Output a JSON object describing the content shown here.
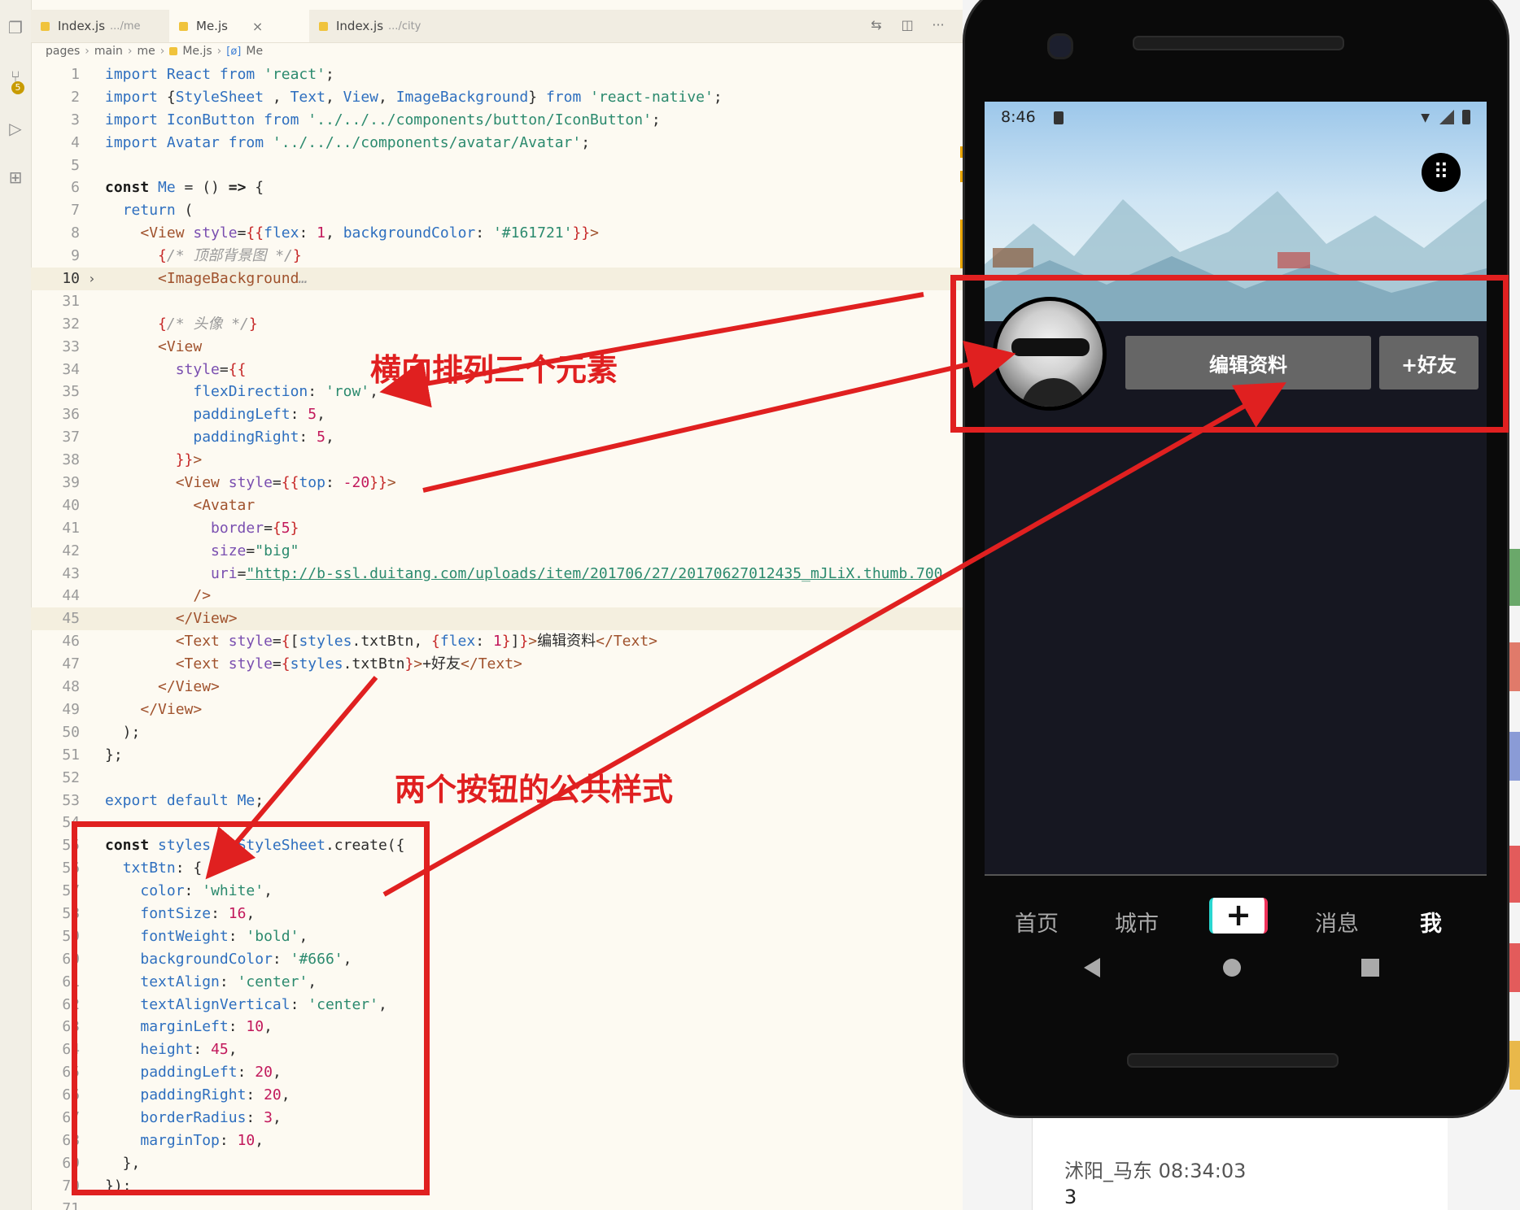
{
  "editor": {
    "tabs": [
      {
        "label": "Index.js",
        "hint": ".../me",
        "active": false
      },
      {
        "label": "Me.js",
        "hint": "",
        "active": true
      },
      {
        "label": "Index.js",
        "hint": ".../city",
        "active": false
      }
    ],
    "tab_close": "×",
    "toolbar_icons": [
      "compare-icon",
      "split-editor-icon",
      "more-icon"
    ],
    "toolbar_glyphs": [
      "⇆",
      "◫",
      "···"
    ],
    "breadcrumb": [
      "pages",
      "main",
      "me",
      "Me.js",
      "Me"
    ],
    "breadcrumb_sep": "›",
    "breadcrumb_sym": "[ø]",
    "scm_badge": "5",
    "activity_glyphs": [
      "❐",
      "⑂",
      "▷",
      "⊞"
    ],
    "fold_glyph": "›",
    "lines": [
      {
        "n": "1",
        "t": [
          [
            "kw2",
            "import "
          ],
          [
            "kw2",
            "React "
          ],
          [
            "kw2",
            "from "
          ],
          [
            "str",
            "'react'"
          ],
          [
            "",
            "; "
          ]
        ]
      },
      {
        "n": "2",
        "t": [
          [
            "kw2",
            "import "
          ],
          [
            "",
            "{"
          ],
          [
            "kw2",
            "StyleSheet"
          ],
          [
            "",
            " , "
          ],
          [
            "kw2",
            "Text"
          ],
          [
            "",
            ", "
          ],
          [
            "kw2",
            "View"
          ],
          [
            "",
            ", "
          ],
          [
            "kw2",
            "ImageBackground"
          ],
          [
            "",
            "} "
          ],
          [
            "kw2",
            "from "
          ],
          [
            "str",
            "'react-native'"
          ],
          [
            "",
            ";"
          ]
        ]
      },
      {
        "n": "3",
        "t": [
          [
            "kw2",
            "import "
          ],
          [
            "kw2",
            "IconButton "
          ],
          [
            "kw2",
            "from "
          ],
          [
            "str",
            "'../../../components/button/IconButton'"
          ],
          [
            "",
            ";"
          ]
        ]
      },
      {
        "n": "4",
        "t": [
          [
            "kw2",
            "import "
          ],
          [
            "kw2",
            "Avatar "
          ],
          [
            "kw2",
            "from "
          ],
          [
            "str",
            "'../../../components/avatar/Avatar'"
          ],
          [
            "",
            ";"
          ]
        ]
      },
      {
        "n": "5",
        "t": []
      },
      {
        "n": "6",
        "t": [
          [
            "kw",
            "const "
          ],
          [
            "prop",
            "Me "
          ],
          [
            "",
            "= () "
          ],
          [
            "kw",
            "=> "
          ],
          [
            "",
            "{"
          ]
        ]
      },
      {
        "n": "7",
        "t": [
          [
            "",
            "  "
          ],
          [
            "kw2",
            "return "
          ],
          [
            "",
            "("
          ]
        ]
      },
      {
        "n": "8",
        "t": [
          [
            "",
            "    "
          ],
          [
            "tag",
            "<View "
          ],
          [
            "attr",
            "style"
          ],
          [
            "",
            "="
          ],
          [
            "brace",
            "{{"
          ],
          [
            "prop",
            "flex"
          ],
          [
            "",
            ": "
          ],
          [
            "num",
            "1"
          ],
          [
            "",
            ", "
          ],
          [
            "prop",
            "backgroundColor"
          ],
          [
            "",
            ": "
          ],
          [
            "str",
            "'#161721'"
          ],
          [
            "brace",
            "}}"
          ],
          [
            "tag",
            ">"
          ]
        ]
      },
      {
        "n": "9",
        "t": [
          [
            "",
            "      "
          ],
          [
            "brace",
            "{"
          ],
          [
            "cmt",
            "/* 顶部背景图 */"
          ],
          [
            "brace",
            "}"
          ]
        ]
      },
      {
        "n": "10",
        "t": [
          [
            "",
            "      "
          ],
          [
            "tag",
            "<ImageBackground"
          ],
          [
            "cmt",
            "…"
          ]
        ]
      },
      {
        "n": "31",
        "t": []
      },
      {
        "n": "32",
        "t": [
          [
            "",
            "      "
          ],
          [
            "brace",
            "{"
          ],
          [
            "cmt",
            "/* 头像 */"
          ],
          [
            "brace",
            "}"
          ]
        ]
      },
      {
        "n": "33",
        "t": [
          [
            "",
            "      "
          ],
          [
            "tag",
            "<View"
          ]
        ]
      },
      {
        "n": "34",
        "t": [
          [
            "",
            "        "
          ],
          [
            "attr",
            "style"
          ],
          [
            "",
            "="
          ],
          [
            "brace",
            "{{"
          ]
        ]
      },
      {
        "n": "35",
        "t": [
          [
            "",
            "          "
          ],
          [
            "prop",
            "flexDirection"
          ],
          [
            "",
            ": "
          ],
          [
            "str",
            "'row'"
          ],
          [
            "",
            ","
          ]
        ]
      },
      {
        "n": "36",
        "t": [
          [
            "",
            "          "
          ],
          [
            "prop",
            "paddingLeft"
          ],
          [
            "",
            ": "
          ],
          [
            "num",
            "5"
          ],
          [
            "",
            ","
          ]
        ]
      },
      {
        "n": "37",
        "t": [
          [
            "",
            "          "
          ],
          [
            "prop",
            "paddingRight"
          ],
          [
            "",
            ": "
          ],
          [
            "num",
            "5"
          ],
          [
            "",
            ","
          ]
        ]
      },
      {
        "n": "38",
        "t": [
          [
            "",
            "        "
          ],
          [
            "brace",
            "}}"
          ],
          [
            "tag",
            ">"
          ]
        ]
      },
      {
        "n": "39",
        "t": [
          [
            "",
            "        "
          ],
          [
            "tag",
            "<View "
          ],
          [
            "attr",
            "style"
          ],
          [
            "",
            "="
          ],
          [
            "brace",
            "{{"
          ],
          [
            "prop",
            "top"
          ],
          [
            "",
            ": "
          ],
          [
            "num",
            "-20"
          ],
          [
            "brace",
            "}}"
          ],
          [
            "tag",
            ">"
          ]
        ]
      },
      {
        "n": "40",
        "t": [
          [
            "",
            "          "
          ],
          [
            "tag",
            "<Avatar"
          ]
        ]
      },
      {
        "n": "41",
        "t": [
          [
            "",
            "            "
          ],
          [
            "attr",
            "border"
          ],
          [
            "",
            "="
          ],
          [
            "brace",
            "{"
          ],
          [
            "num",
            "5"
          ],
          [
            "brace",
            "}"
          ]
        ]
      },
      {
        "n": "42",
        "t": [
          [
            "",
            "            "
          ],
          [
            "attr",
            "size"
          ],
          [
            "",
            "="
          ],
          [
            "str",
            "\"big\""
          ]
        ]
      },
      {
        "n": "43",
        "t": [
          [
            "",
            "            "
          ],
          [
            "attr",
            "uri"
          ],
          [
            "",
            "="
          ],
          [
            "link",
            "\"http://b-ssl.duitang.com/uploads/item/201706/27/20170627012435_mJLiX.thumb.700"
          ]
        ]
      },
      {
        "n": "44",
        "t": [
          [
            "",
            "          "
          ],
          [
            "tag",
            "/>"
          ]
        ]
      },
      {
        "n": "45",
        "t": [
          [
            "",
            "        "
          ],
          [
            "tag",
            "</View>"
          ]
        ]
      },
      {
        "n": "46",
        "t": [
          [
            "",
            "        "
          ],
          [
            "tag",
            "<Text "
          ],
          [
            "attr",
            "style"
          ],
          [
            "",
            "="
          ],
          [
            "brace",
            "{"
          ],
          [
            "",
            "["
          ],
          [
            "prop",
            "styles"
          ],
          [
            "",
            ".txtBtn, "
          ],
          [
            "brace",
            "{"
          ],
          [
            "prop",
            "flex"
          ],
          [
            "",
            ": "
          ],
          [
            "num",
            "1"
          ],
          [
            "brace",
            "}"
          ],
          [
            "",
            "]"
          ],
          [
            "brace",
            "}"
          ],
          [
            "tag",
            ">"
          ],
          [
            "",
            "编辑资料"
          ],
          [
            "tag",
            "</Text>"
          ]
        ]
      },
      {
        "n": "47",
        "t": [
          [
            "",
            "        "
          ],
          [
            "tag",
            "<Text "
          ],
          [
            "attr",
            "style"
          ],
          [
            "",
            "="
          ],
          [
            "brace",
            "{"
          ],
          [
            "prop",
            "styles"
          ],
          [
            "",
            ".txtBtn"
          ],
          [
            "brace",
            "}"
          ],
          [
            "tag",
            ">"
          ],
          [
            "",
            "+好友"
          ],
          [
            "tag",
            "</Text>"
          ]
        ]
      },
      {
        "n": "48",
        "t": [
          [
            "",
            "      "
          ],
          [
            "tag",
            "</View>"
          ]
        ]
      },
      {
        "n": "49",
        "t": [
          [
            "",
            "    "
          ],
          [
            "tag",
            "</View>"
          ]
        ]
      },
      {
        "n": "50",
        "t": [
          [
            "",
            "  );"
          ]
        ]
      },
      {
        "n": "51",
        "t": [
          [
            "",
            "};"
          ]
        ]
      },
      {
        "n": "52",
        "t": []
      },
      {
        "n": "53",
        "t": [
          [
            "kw2",
            "export "
          ],
          [
            "kw2",
            "default "
          ],
          [
            "prop",
            "Me"
          ],
          [
            "",
            ";"
          ]
        ]
      },
      {
        "n": "54",
        "t": []
      },
      {
        "n": "55",
        "t": [
          [
            "kw",
            "const "
          ],
          [
            "prop",
            "styles "
          ],
          [
            "",
            "= "
          ],
          [
            "kw2",
            "StyleSheet"
          ],
          [
            "",
            ".create({"
          ]
        ]
      },
      {
        "n": "56",
        "t": [
          [
            "",
            "  "
          ],
          [
            "prop",
            "txtBtn"
          ],
          [
            "",
            ": {"
          ]
        ]
      },
      {
        "n": "57",
        "t": [
          [
            "",
            "    "
          ],
          [
            "prop",
            "color"
          ],
          [
            "",
            ": "
          ],
          [
            "str",
            "'white'"
          ],
          [
            "",
            ","
          ]
        ]
      },
      {
        "n": "58",
        "t": [
          [
            "",
            "    "
          ],
          [
            "prop",
            "fontSize"
          ],
          [
            "",
            ": "
          ],
          [
            "num",
            "16"
          ],
          [
            "",
            ","
          ]
        ]
      },
      {
        "n": "59",
        "t": [
          [
            "",
            "    "
          ],
          [
            "prop",
            "fontWeight"
          ],
          [
            "",
            ": "
          ],
          [
            "str",
            "'bold'"
          ],
          [
            "",
            ","
          ]
        ]
      },
      {
        "n": "60",
        "t": [
          [
            "",
            "    "
          ],
          [
            "prop",
            "backgroundColor"
          ],
          [
            "",
            ": "
          ],
          [
            "str",
            "'#666'"
          ],
          [
            "",
            ","
          ]
        ]
      },
      {
        "n": "61",
        "t": [
          [
            "",
            "    "
          ],
          [
            "prop",
            "textAlign"
          ],
          [
            "",
            ": "
          ],
          [
            "str",
            "'center'"
          ],
          [
            "",
            ","
          ]
        ]
      },
      {
        "n": "62",
        "t": [
          [
            "",
            "    "
          ],
          [
            "prop",
            "textAlignVertical"
          ],
          [
            "",
            ": "
          ],
          [
            "str",
            "'center'"
          ],
          [
            "",
            ","
          ]
        ]
      },
      {
        "n": "63",
        "t": [
          [
            "",
            "    "
          ],
          [
            "prop",
            "marginLeft"
          ],
          [
            "",
            ": "
          ],
          [
            "num",
            "10"
          ],
          [
            "",
            ","
          ]
        ]
      },
      {
        "n": "64",
        "t": [
          [
            "",
            "    "
          ],
          [
            "prop",
            "height"
          ],
          [
            "",
            ": "
          ],
          [
            "num",
            "45"
          ],
          [
            "",
            ","
          ]
        ]
      },
      {
        "n": "65",
        "t": [
          [
            "",
            "    "
          ],
          [
            "prop",
            "paddingLeft"
          ],
          [
            "",
            ": "
          ],
          [
            "num",
            "20"
          ],
          [
            "",
            ","
          ]
        ]
      },
      {
        "n": "66",
        "t": [
          [
            "",
            "    "
          ],
          [
            "prop",
            "paddingRight"
          ],
          [
            "",
            ": "
          ],
          [
            "num",
            "20"
          ],
          [
            "",
            ","
          ]
        ]
      },
      {
        "n": "67",
        "t": [
          [
            "",
            "    "
          ],
          [
            "prop",
            "borderRadius"
          ],
          [
            "",
            ": "
          ],
          [
            "num",
            "3"
          ],
          [
            "",
            ","
          ]
        ]
      },
      {
        "n": "68",
        "t": [
          [
            "",
            "    "
          ],
          [
            "prop",
            "marginTop"
          ],
          [
            "",
            ": "
          ],
          [
            "num",
            "10"
          ],
          [
            "",
            ","
          ]
        ]
      },
      {
        "n": "69",
        "t": [
          [
            "",
            "  },"
          ]
        ]
      },
      {
        "n": "70",
        "t": [
          [
            "",
            "});"
          ]
        ]
      },
      {
        "n": "71",
        "t": []
      }
    ]
  },
  "phone": {
    "status_time": "8:46",
    "wifi_glyph": "▼",
    "grid_glyph": "⠿",
    "buttons": {
      "edit": "编辑资料",
      "add_friend": "+好友"
    },
    "tabs": [
      "首页",
      "城市",
      "+",
      "消息",
      "我"
    ],
    "active_tab": "我"
  },
  "annotations": {
    "row_note": "横向排列三个元素",
    "style_note": "两个按钮的公共样式"
  },
  "background_chat": {
    "name": "沭阳_马东 08:34:03",
    "count": "3"
  },
  "colors": {
    "annotation_red": "#e02020",
    "screen_bg": "#161721",
    "button_bg": "#666666"
  }
}
